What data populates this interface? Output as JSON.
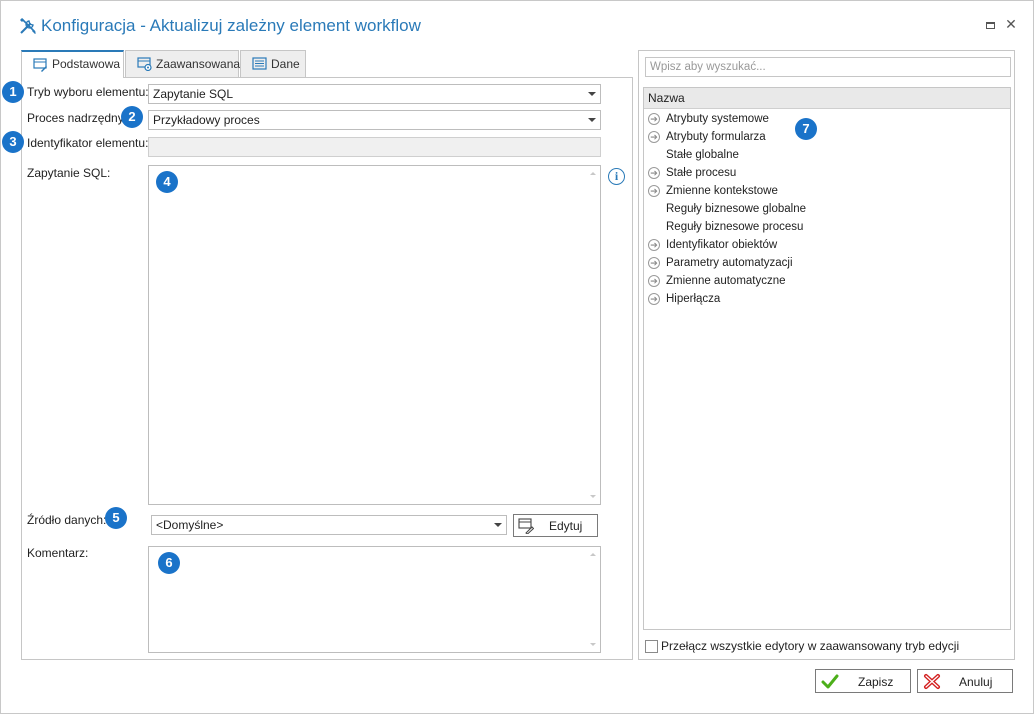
{
  "window": {
    "title": "Konfiguracja - Aktualizuj zależny element workflow",
    "title_icon": "tools-icon",
    "controls": [
      "maximize-icon",
      "close-icon"
    ],
    "close_glyph": "✕"
  },
  "tabs": [
    {
      "label": "Podstawowa",
      "icon": "basic-tab-icon",
      "active": true
    },
    {
      "label": "Zaawansowana",
      "icon": "advanced-tab-icon",
      "active": false
    },
    {
      "label": "Dane",
      "icon": "data-tab-icon",
      "active": false
    }
  ],
  "form": {
    "selection_mode": {
      "label": "Tryb wyboru elementu:",
      "value": "Zapytanie SQL"
    },
    "parent_process": {
      "label": "Proces nadrzędny:",
      "value": "Przykładowy proces"
    },
    "element_id": {
      "label": "Identyfikator elementu:",
      "value": ""
    },
    "sql_query": {
      "label": "Zapytanie SQL:",
      "value": ""
    },
    "data_source": {
      "label": "Źródło danych:",
      "value": "<Domyślne>",
      "edit_button": "Edytuj"
    },
    "comment": {
      "label": "Komentarz:",
      "value": ""
    },
    "info_glyph": "i"
  },
  "badges": [
    "1",
    "2",
    "3",
    "4",
    "5",
    "6",
    "7"
  ],
  "right_panel": {
    "search_placeholder": "Wpisz aby wyszukać...",
    "column_header": "Nazwa",
    "items": [
      {
        "label": "Atrybuty systemowe",
        "expandable": true
      },
      {
        "label": "Atrybuty formularza",
        "expandable": true
      },
      {
        "label": "Stałe globalne",
        "expandable": false
      },
      {
        "label": "Stałe procesu",
        "expandable": true
      },
      {
        "label": "Zmienne kontekstowe",
        "expandable": true
      },
      {
        "label": "Reguły biznesowe globalne",
        "expandable": false
      },
      {
        "label": "Reguły biznesowe procesu",
        "expandable": false
      },
      {
        "label": "Identyfikator obiektów",
        "expandable": true
      },
      {
        "label": "Parametry automatyzacji",
        "expandable": true
      },
      {
        "label": "Zmienne automatyczne",
        "expandable": true
      },
      {
        "label": "Hiperłącza",
        "expandable": true
      }
    ],
    "advanced_toggle": {
      "label": "Przełącz wszystkie edytory w zaawansowany tryb edycji",
      "checked": false
    }
  },
  "footer": {
    "save_label": "Zapisz",
    "cancel_label": "Anuluj"
  },
  "colors": {
    "accent": "#2a7ab8",
    "badge": "#1a73c9",
    "save_check": "#4caf1a",
    "cancel_x": "#d32020"
  }
}
